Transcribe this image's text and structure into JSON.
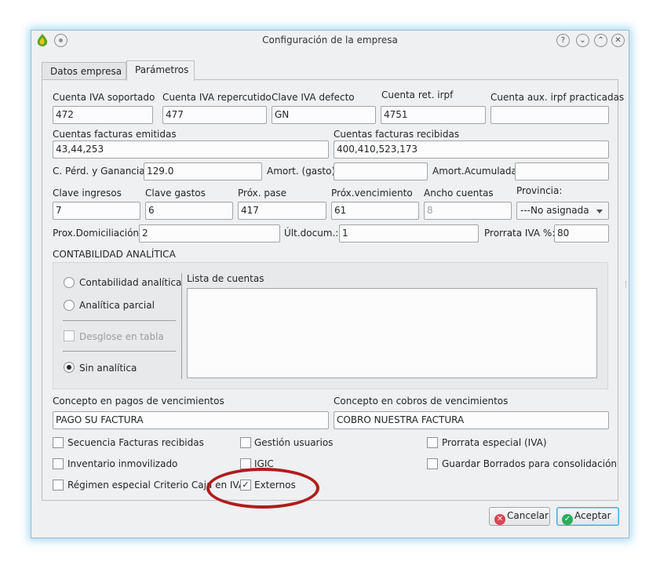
{
  "window": {
    "title": "Configuración de la empresa"
  },
  "tabs": [
    {
      "label": "Datos empresa"
    },
    {
      "label": "Parámetros"
    }
  ],
  "fields": {
    "cuenta_iva_soportado": {
      "label": "Cuenta IVA soportado",
      "value": "472"
    },
    "cuenta_iva_repercutido": {
      "label": "Cuenta IVA repercutido",
      "value": "477"
    },
    "clave_iva_defecto": {
      "label": "Clave IVA defecto",
      "value": "GN"
    },
    "cuenta_ret_irpf": {
      "label": "Cuenta ret. irpf",
      "value": "4751"
    },
    "cuenta_aux_irpf": {
      "label": "Cuenta aux. irpf practicadas",
      "value": ""
    },
    "cuentas_emitidas": {
      "label": "Cuentas facturas emitidas",
      "value": "43,44,253"
    },
    "cuentas_recibidas": {
      "label": "Cuentas facturas recibidas",
      "value": "400,410,523,173"
    },
    "perd_ganancias": {
      "label": "C. Pérd. y Ganancias:",
      "value": "129.0"
    },
    "amort_gasto": {
      "label": "Amort. (gasto)",
      "value": ""
    },
    "amort_acumulada": {
      "label": "Amort.Acumulada",
      "value": ""
    },
    "clave_ingresos": {
      "label": "Clave ingresos",
      "value": "7"
    },
    "clave_gastos": {
      "label": "Clave gastos",
      "value": "6"
    },
    "prox_pase": {
      "label": "Próx. pase",
      "value": "417"
    },
    "prox_vencimiento": {
      "label": "Próx.vencimiento",
      "value": "61"
    },
    "ancho_cuentas": {
      "label": "Ancho cuentas",
      "value": "8"
    },
    "provincia": {
      "label": "Provincia:",
      "value": "---No asignada"
    },
    "prox_domiciliacion": {
      "label": "Prox.Domiciliación:",
      "value": "2"
    },
    "ult_docum": {
      "label": "Últ.docum.:",
      "value": "1"
    },
    "prorrata_iva": {
      "label": "Prorrata IVA %:",
      "value": "80"
    },
    "concepto_pagos": {
      "label": "Concepto en pagos de vencimientos",
      "value": "PAGO SU FACTURA"
    },
    "concepto_cobros": {
      "label": "Concepto en cobros de vencimientos",
      "value": "COBRO NUESTRA FACTURA"
    }
  },
  "analitica": {
    "heading": "CONTABILIDAD ANALÍTICA",
    "options": [
      {
        "label": "Contabilidad analítica",
        "selected": false
      },
      {
        "label": "Analítica parcial",
        "selected": false
      },
      {
        "label": "Sin analítica",
        "selected": true
      }
    ],
    "desglose": {
      "label": "Desglose en tabla",
      "checked": false,
      "enabled": false
    },
    "lista_label": "Lista de cuentas"
  },
  "checkboxes": [
    {
      "label": "Secuencia Facturas recibidas",
      "checked": false
    },
    {
      "label": "Gestión usuarios",
      "checked": false
    },
    {
      "label": "Prorrata especial (IVA)",
      "checked": false
    },
    {
      "label": "Inventario inmovilizado",
      "checked": false
    },
    {
      "label": "IGIC",
      "checked": false
    },
    {
      "label": "Guardar Borrados para consolidación",
      "checked": false
    },
    {
      "label": "Régimen especial Criterio Caja en IVA",
      "checked": false
    },
    {
      "label": "Externos",
      "checked": true
    }
  ],
  "buttons": {
    "cancel": "Cancelar",
    "accept": "Aceptar"
  },
  "colors": {
    "accent": "#3daee9",
    "annotation": "#b01c1c",
    "cancel_icon": "#da4453",
    "accept_icon": "#27ae60"
  },
  "icons": [
    "app-icon",
    "window-menu-icon",
    "help-icon",
    "minimize-icon",
    "maximize-icon",
    "close-icon",
    "cancel-icon",
    "accept-icon",
    "dropdown-arrow-icon"
  ]
}
